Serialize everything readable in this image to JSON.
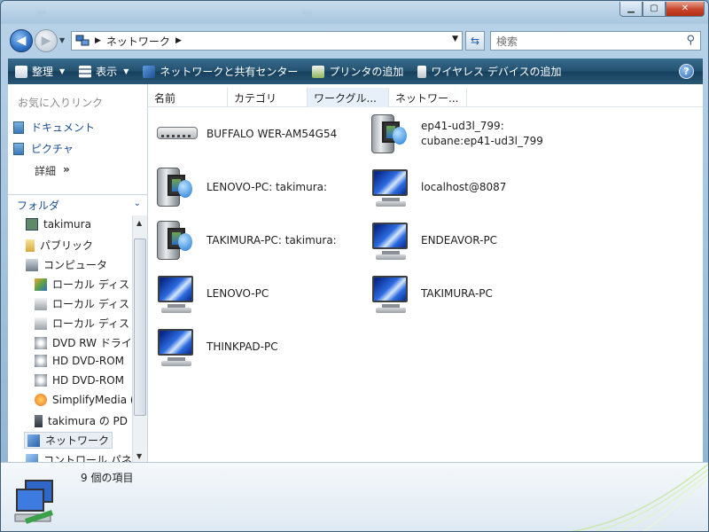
{
  "window": {
    "blurred_title_left": "…",
    "blurred_title_right": "…"
  },
  "nav": {
    "breadcrumb": [
      "ネットワーク"
    ]
  },
  "search": {
    "placeholder": "検索"
  },
  "toolbar": {
    "organize": "整理",
    "views": "表示",
    "network_center": "ネットワークと共有センター",
    "add_printer": "プリンタの追加",
    "add_wireless": "ワイヤレス デバイスの追加",
    "help": "?"
  },
  "favorites": {
    "header": "お気に入りリンク",
    "items": [
      {
        "label": "ドキュメント"
      },
      {
        "label": "ピクチャ"
      }
    ],
    "more": "詳細",
    "more_arrow": "»"
  },
  "folders": {
    "header": "フォルダ",
    "items": [
      {
        "label": "takimura",
        "icon": "user-folder-icon"
      },
      {
        "label": "パブリック",
        "icon": "folder-icon"
      },
      {
        "label": "コンピュータ",
        "icon": "computer-icon"
      },
      {
        "label": "ローカル ディス",
        "icon": "os-drive-icon"
      },
      {
        "label": "ローカル ディス",
        "icon": "drive-icon"
      },
      {
        "label": "ローカル ディス",
        "icon": "drive-icon"
      },
      {
        "label": "DVD RW ドライ",
        "icon": "dvd-drive-icon"
      },
      {
        "label": "HD DVD-ROM",
        "icon": "dvd-drive-icon"
      },
      {
        "label": "HD DVD-ROM",
        "icon": "dvd-drive-icon"
      },
      {
        "label": "SimplifyMedia (",
        "icon": "simplifymedia-icon"
      },
      {
        "label": "takimura の PD",
        "icon": "pda-icon"
      },
      {
        "label": "ネットワーク",
        "icon": "network-icon"
      },
      {
        "label": "コントロール パネ",
        "icon": "control-panel-icon"
      }
    ]
  },
  "columns": [
    "名前",
    "カテゴリ",
    "ワークグル...",
    "ネットワー..."
  ],
  "devices": [
    {
      "name": "BUFFALO WER-AM54G54",
      "type": "router"
    },
    {
      "name": "ep41-ud3l_799:\ncubane:ep41-ud3l_799",
      "line1": "ep41-ud3l_799:",
      "line2": "cubane:ep41-ud3l_799",
      "type": "media-server"
    },
    {
      "name": "LENOVO-PC: takimura:",
      "type": "media-server"
    },
    {
      "name": "localhost@8087",
      "type": "computer"
    },
    {
      "name": "TAKIMURA-PC: takimura:",
      "type": "media-server"
    },
    {
      "name": "ENDEAVOR-PC",
      "type": "computer"
    },
    {
      "name": "LENOVO-PC",
      "type": "computer"
    },
    {
      "name": "TAKIMURA-PC",
      "type": "computer"
    },
    {
      "name": "THINKPAD-PC",
      "type": "computer"
    }
  ],
  "status": {
    "count": "9 個の項目"
  }
}
